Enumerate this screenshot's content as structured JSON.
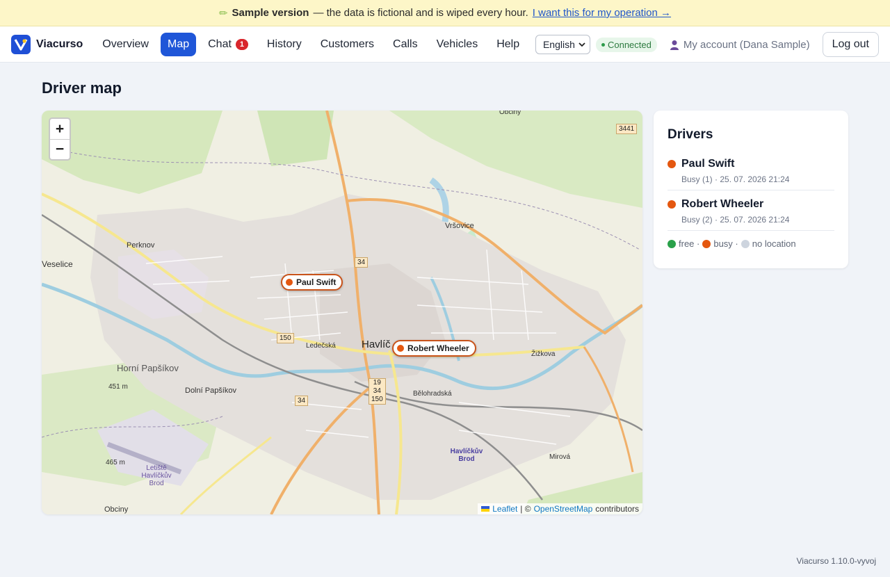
{
  "banner": {
    "title": "Sample version",
    "text": "— the data is fictional and is wiped every hour.",
    "link": "I want this for my operation →"
  },
  "nav": {
    "brand": "Viacurso",
    "items": [
      "Overview",
      "Map",
      "Chat",
      "History",
      "Customers",
      "Calls",
      "Vehicles",
      "Help"
    ],
    "chat_badge": "1",
    "language": "English",
    "status": "Connected",
    "account": "My account (Dana Sample)",
    "logout": "Log out"
  },
  "page": {
    "title": "Driver map"
  },
  "map": {
    "zoom_in": "+",
    "zoom_out": "−",
    "drivers": [
      {
        "name": "Paul Swift"
      },
      {
        "name": "Robert Wheeler"
      }
    ],
    "labels": {
      "town": "Havlíč",
      "perknov": "Perknov",
      "vrsovice": "Vršovice",
      "veselice": "Veselice",
      "horni": "Horní Papšíkov",
      "dolni": "Dolní Papšíkov",
      "obciny_top": "Obciny",
      "obciny_bottom": "Obciny",
      "letiste": "Letiště Havlíčkův Brod",
      "brod": "Havlíčkův Brod",
      "alt1": "451 m",
      "alt2": "465 m",
      "zizkova": "Žižkova",
      "ledecska": "Ledečská",
      "mirova": "Mirová",
      "belohradska": "Bělohradská"
    },
    "shields": [
      "34",
      "150",
      "34",
      "3441",
      "19",
      "34",
      "150"
    ],
    "attribution": {
      "leaflet": "Leaflet",
      "sep": "| ©",
      "osm": "OpenStreetMap",
      "tail": "contributors"
    }
  },
  "drivers_panel": {
    "title": "Drivers",
    "items": [
      {
        "name": "Paul Swift",
        "meta": "Busy (1) · 25. 07. 2026 21:24"
      },
      {
        "name": "Robert Wheeler",
        "meta": "Busy (2) · 25. 07. 2026 21:24"
      }
    ],
    "legend": {
      "free": "free ·",
      "busy": "busy ·",
      "none": "no location"
    }
  },
  "colors": {
    "free": "#2aa14a",
    "busy": "#e4570f",
    "none": "#cdd4de",
    "accent": "#1f56d8"
  },
  "footer": {
    "version": "Viacurso 1.10.0-vyvoj"
  }
}
